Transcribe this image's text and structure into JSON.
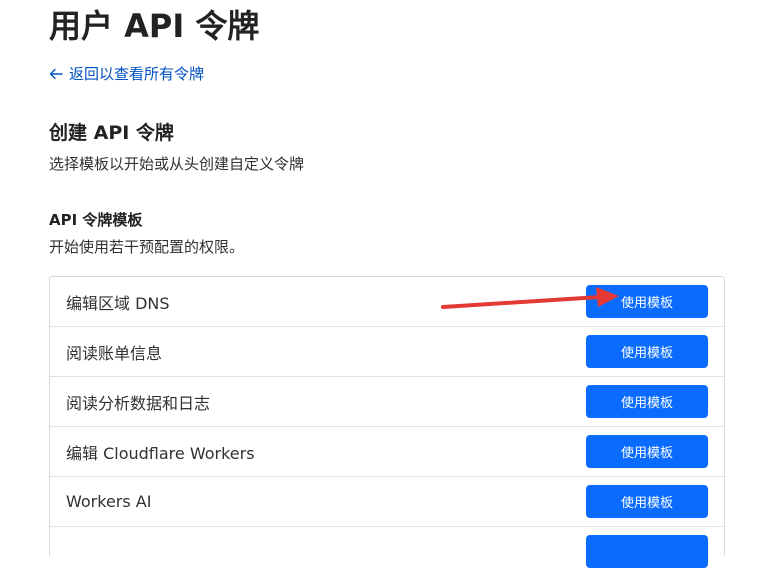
{
  "page": {
    "title": "用户 API 令牌",
    "back_link": "返回以查看所有令牌"
  },
  "create_section": {
    "title": "创建 API 令牌",
    "description": "选择模板以开始或从头创建自定义令牌"
  },
  "templates_section": {
    "title": "API 令牌模板",
    "description": "开始使用若干预配置的权限。",
    "button_label": "使用模板",
    "items": [
      {
        "label": "编辑区域 DNS",
        "button": "使用模板"
      },
      {
        "label": "阅读账单信息",
        "button": "使用模板"
      },
      {
        "label": "阅读分析数据和日志",
        "button": "使用模板"
      },
      {
        "label": "编辑 Cloudflare Workers",
        "button": "使用模板"
      },
      {
        "label": "Workers AI",
        "button": "使用模板"
      }
    ]
  },
  "icons": {
    "back": "arrow-left-icon",
    "annotation": "red-arrow-annotation"
  },
  "colors": {
    "accent": "#0a6cff",
    "link": "#0051c3",
    "annotation": "#e53935"
  }
}
